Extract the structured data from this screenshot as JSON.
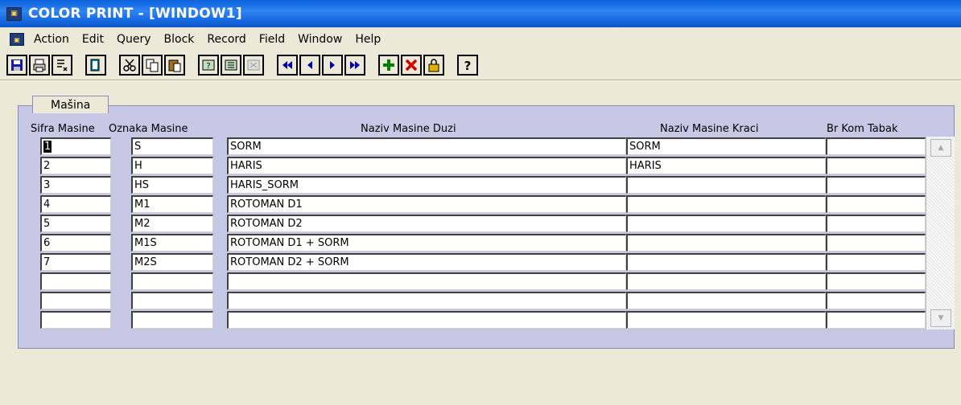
{
  "window": {
    "title": "COLOR PRINT - [WINDOW1]",
    "icon": "oracle-forms-icon"
  },
  "menu": [
    "Action",
    "Edit",
    "Query",
    "Block",
    "Record",
    "Field",
    "Window",
    "Help"
  ],
  "toolbar": [
    {
      "icon": "save-icon"
    },
    {
      "icon": "print-icon"
    },
    {
      "icon": "clear-form-icon"
    },
    {
      "icon": "exit-icon"
    },
    {
      "icon": "cut-icon"
    },
    {
      "icon": "copy-icon"
    },
    {
      "icon": "paste-icon"
    },
    {
      "icon": "enter-query-icon"
    },
    {
      "icon": "execute-query-icon"
    },
    {
      "icon": "cancel-query-icon"
    },
    {
      "icon": "first-record-icon"
    },
    {
      "icon": "previous-record-icon"
    },
    {
      "icon": "next-record-icon"
    },
    {
      "icon": "last-record-icon"
    },
    {
      "icon": "insert-record-icon"
    },
    {
      "icon": "delete-record-icon"
    },
    {
      "icon": "lock-record-icon"
    },
    {
      "icon": "help-icon"
    }
  ],
  "block": {
    "label": "Mašina",
    "columns": [
      "Sifra Masine",
      "Oznaka Masine",
      "Naziv Masine Duzi",
      "Naziv Masine Kraci",
      "Br Kom Tabak"
    ],
    "rows": [
      [
        "1",
        "S",
        "SORM",
        "SORM",
        ""
      ],
      [
        "2",
        "H",
        "HARIS",
        "HARIS",
        ""
      ],
      [
        "3",
        "HS",
        "HARIS_SORM",
        "",
        ""
      ],
      [
        "4",
        "M1",
        "ROTOMAN D1",
        "",
        ""
      ],
      [
        "5",
        "M2",
        "ROTOMAN D2",
        "",
        ""
      ],
      [
        "6",
        "M1S",
        "ROTOMAN D1 + SORM",
        "",
        ""
      ],
      [
        "7",
        "M2S",
        "ROTOMAN D2 + SORM",
        "",
        ""
      ],
      [
        "",
        "",
        "",
        "",
        ""
      ],
      [
        "",
        "",
        "",
        "",
        ""
      ],
      [
        "",
        "",
        "",
        "",
        ""
      ]
    ]
  }
}
